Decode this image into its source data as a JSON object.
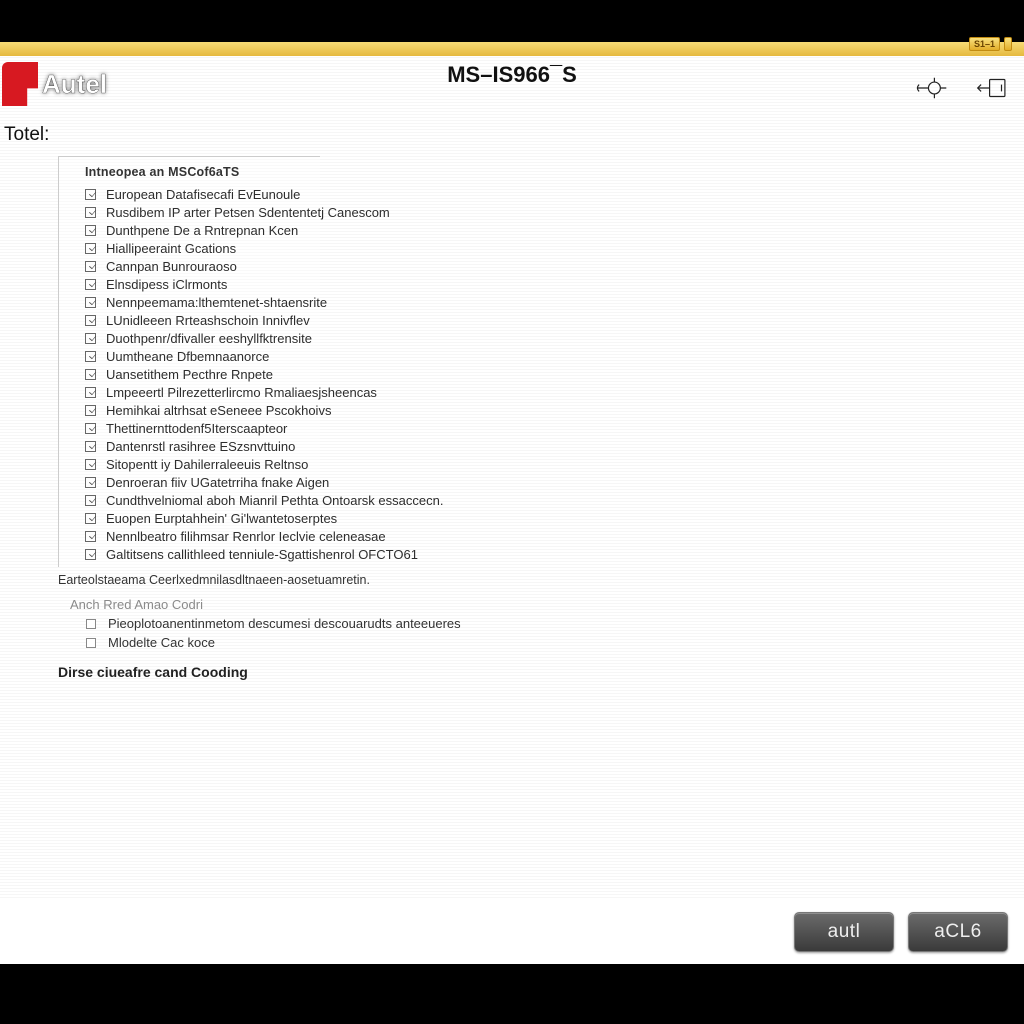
{
  "header": {
    "title": "MS–IS966¯S",
    "brand": "Autel",
    "badge": "S1–1"
  },
  "totel_label": "Totel:",
  "panel": {
    "title": "Intneopea an MSCof6aTS",
    "items": [
      "European Datafisecafi EvEunoule",
      "Rusdibem IP arter Petsen Sdententetj Canescom",
      "Dunthpene De a Rntrepnan Kcen",
      "Hiallipeeraint Gcations",
      "Cannpan Bunrouraoso",
      "Elnsdipess iClrmonts",
      "Nennpeemama:lthemtenet-shtaensrite",
      "LUnidleeen Rrteashschoin Innivflev",
      "Duothpenr/dfivaller eeshyllfktrensite",
      "Uumtheane Dfbemnaanorce",
      "Uansetithem Pecthre Rnpete",
      "Lmpeeertl Pilrezetterlircmo Rmaliaesjsheencas",
      "Hemihkai altrhsat eSeneee Pscokhoivs",
      "Thettinernttodenf5Iterscaapteor",
      "Dantenrstl rasihree ESzsnvttuino",
      "Sitopentt iy Dahilerraleeuis Reltnso",
      "Denroeran fiiv UGatetrriha fnake Aigen",
      "Cundthvelniomal aboh Mianril Pethta Ontoarsk essaccecn.",
      "Euopen Eurptahhein' Gi'lwantetoserptes",
      "Nennlbeatro filihmsar Renrlor Ieclvie celeneasae",
      "Galtitsens callithleed tenniule-Sgattishenrol OFCTO61"
    ]
  },
  "caption": "Earteolstaeama Ceerlxedmnilasdltnaeen-aosetuamretin.",
  "sub_header": "Anch  Rred  Amao  Codri",
  "options": [
    "Pieoplotoanentinmetom descumesi descouarudts anteeueres",
    "Mlodelte Cac koce"
  ],
  "section_title": "Dirse ciueafre cand Cooding",
  "footer": {
    "btn1": "autl",
    "btn2": "aCL6"
  }
}
